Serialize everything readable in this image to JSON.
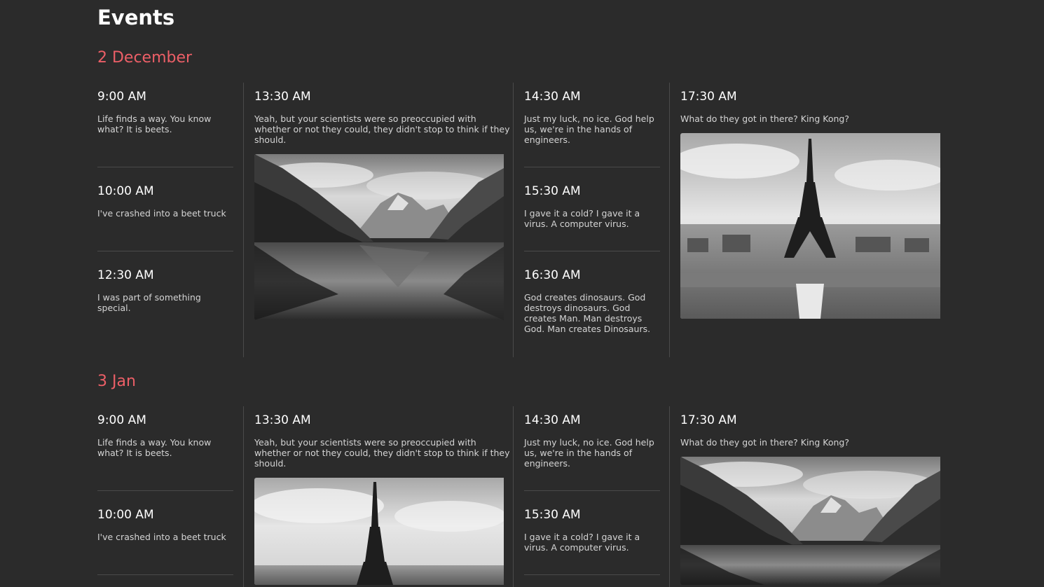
{
  "page": {
    "title": "Events"
  },
  "days": [
    {
      "heading": "2 December",
      "col1": [
        {
          "time": "9:00 AM",
          "desc": "Life finds a way. You know what? It is beets."
        },
        {
          "time": "10:00 AM",
          "desc": "I've crashed into a beet truck"
        },
        {
          "time": "12:30 AM",
          "desc": "I was part of something special."
        }
      ],
      "col2": {
        "time": "13:30 AM",
        "desc": "Yeah, but your scientists were so preoccupied with whether or not they could, they didn't stop to think if they should.",
        "image": "mountain-lake"
      },
      "col3": [
        {
          "time": "14:30 AM",
          "desc": "Just my luck, no ice. God help us, we're in the hands of engineers."
        },
        {
          "time": "15:30 AM",
          "desc": "I gave it a cold? I gave it a virus. A computer virus."
        },
        {
          "time": "16:30 AM",
          "desc": "God creates dinosaurs. God destroys dinosaurs. God creates Man. Man destroys God. Man creates Dinosaurs."
        }
      ],
      "col4": {
        "time": "17:30 AM",
        "desc": "What do they got in there? King Kong?",
        "image": "eiffel-tower"
      }
    },
    {
      "heading": "3 Jan",
      "col1": [
        {
          "time": "9:00 AM",
          "desc": "Life finds a way. You know what? It is beets."
        },
        {
          "time": "10:00 AM",
          "desc": "I've crashed into a beet truck"
        }
      ],
      "col2": {
        "time": "13:30 AM",
        "desc": "Yeah, but your scientists were so preoccupied with whether or not they could, they didn't stop to think if they should.",
        "image": "eiffel-tower"
      },
      "col3": [
        {
          "time": "14:30 AM",
          "desc": "Just my luck, no ice. God help us, we're in the hands of engineers."
        },
        {
          "time": "15:30 AM",
          "desc": "I gave it a cold? I gave it a virus. A computer virus."
        }
      ],
      "col4": {
        "time": "17:30 AM",
        "desc": "What do they got in there? King Kong?",
        "image": "mountain-lake"
      }
    }
  ]
}
